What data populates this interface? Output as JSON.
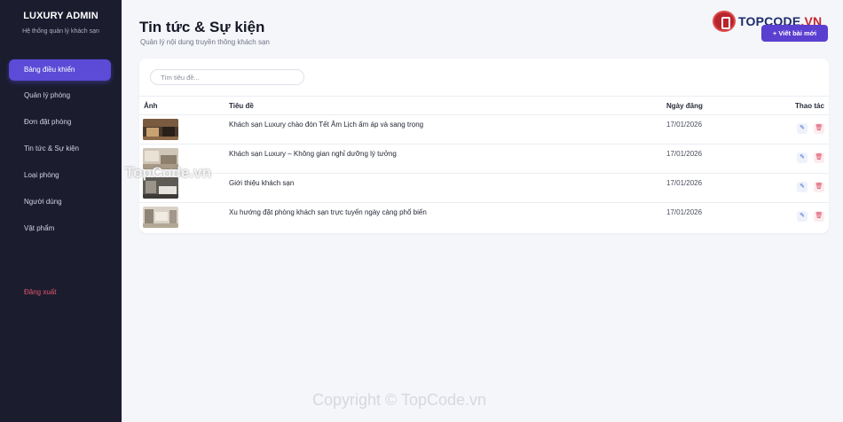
{
  "sidebar": {
    "brand": "LUXURY ADMIN",
    "brand_sub": "Hệ thống quản lý khách sạn",
    "items": [
      {
        "label": "Bảng điều khiển"
      },
      {
        "label": "Quản lý phòng"
      },
      {
        "label": "Đơn đặt phòng"
      },
      {
        "label": "Tin tức & Sự kiện"
      },
      {
        "label": "Loại phòng"
      },
      {
        "label": "Người dùng"
      },
      {
        "label": "Vật phẩm"
      }
    ],
    "active_item": "Bảng điều khiển",
    "logout": "Đăng xuất"
  },
  "header": {
    "title": "Tin tức & Sự kiện",
    "subtitle": "Quản lý nội dung truyền thông khách sạn",
    "new_button": "+ Viết bài mới"
  },
  "logo": {
    "text": "TOPCODE",
    "suffix": ".VN"
  },
  "search": {
    "placeholder": "Tìm tiêu đề...",
    "value": ""
  },
  "table": {
    "columns": [
      "Ảnh",
      "Tiêu đề",
      "Ngày đăng",
      "Thao tác"
    ],
    "rows": [
      {
        "title": "Khách sạn Luxury chào đón Tết Âm Lịch ấm áp và sang trọng",
        "date": "17/01/2026",
        "thumb": "hotel-lobby"
      },
      {
        "title": "Khách sạn Luxury – Không gian nghỉ dưỡng lý tưởng",
        "date": "17/01/2026",
        "thumb": "hotel-room"
      },
      {
        "title": "Giới thiệu khách sạn",
        "date": "17/01/2026",
        "thumb": "hotel-bedroom"
      },
      {
        "title": "Xu hướng đặt phòng khách sạn trực tuyến ngày càng phổ biến",
        "date": "17/01/2026",
        "thumb": "hotel-suite"
      }
    ]
  },
  "watermarks": {
    "mid": "TopCode.vn",
    "bottom": "Copyright © TopCode.vn"
  },
  "colors": {
    "sidebar_bg": "#1b1c2e",
    "accent": "#5b4bd6",
    "button": "#5b3fd0",
    "logout": "#e2566a"
  }
}
